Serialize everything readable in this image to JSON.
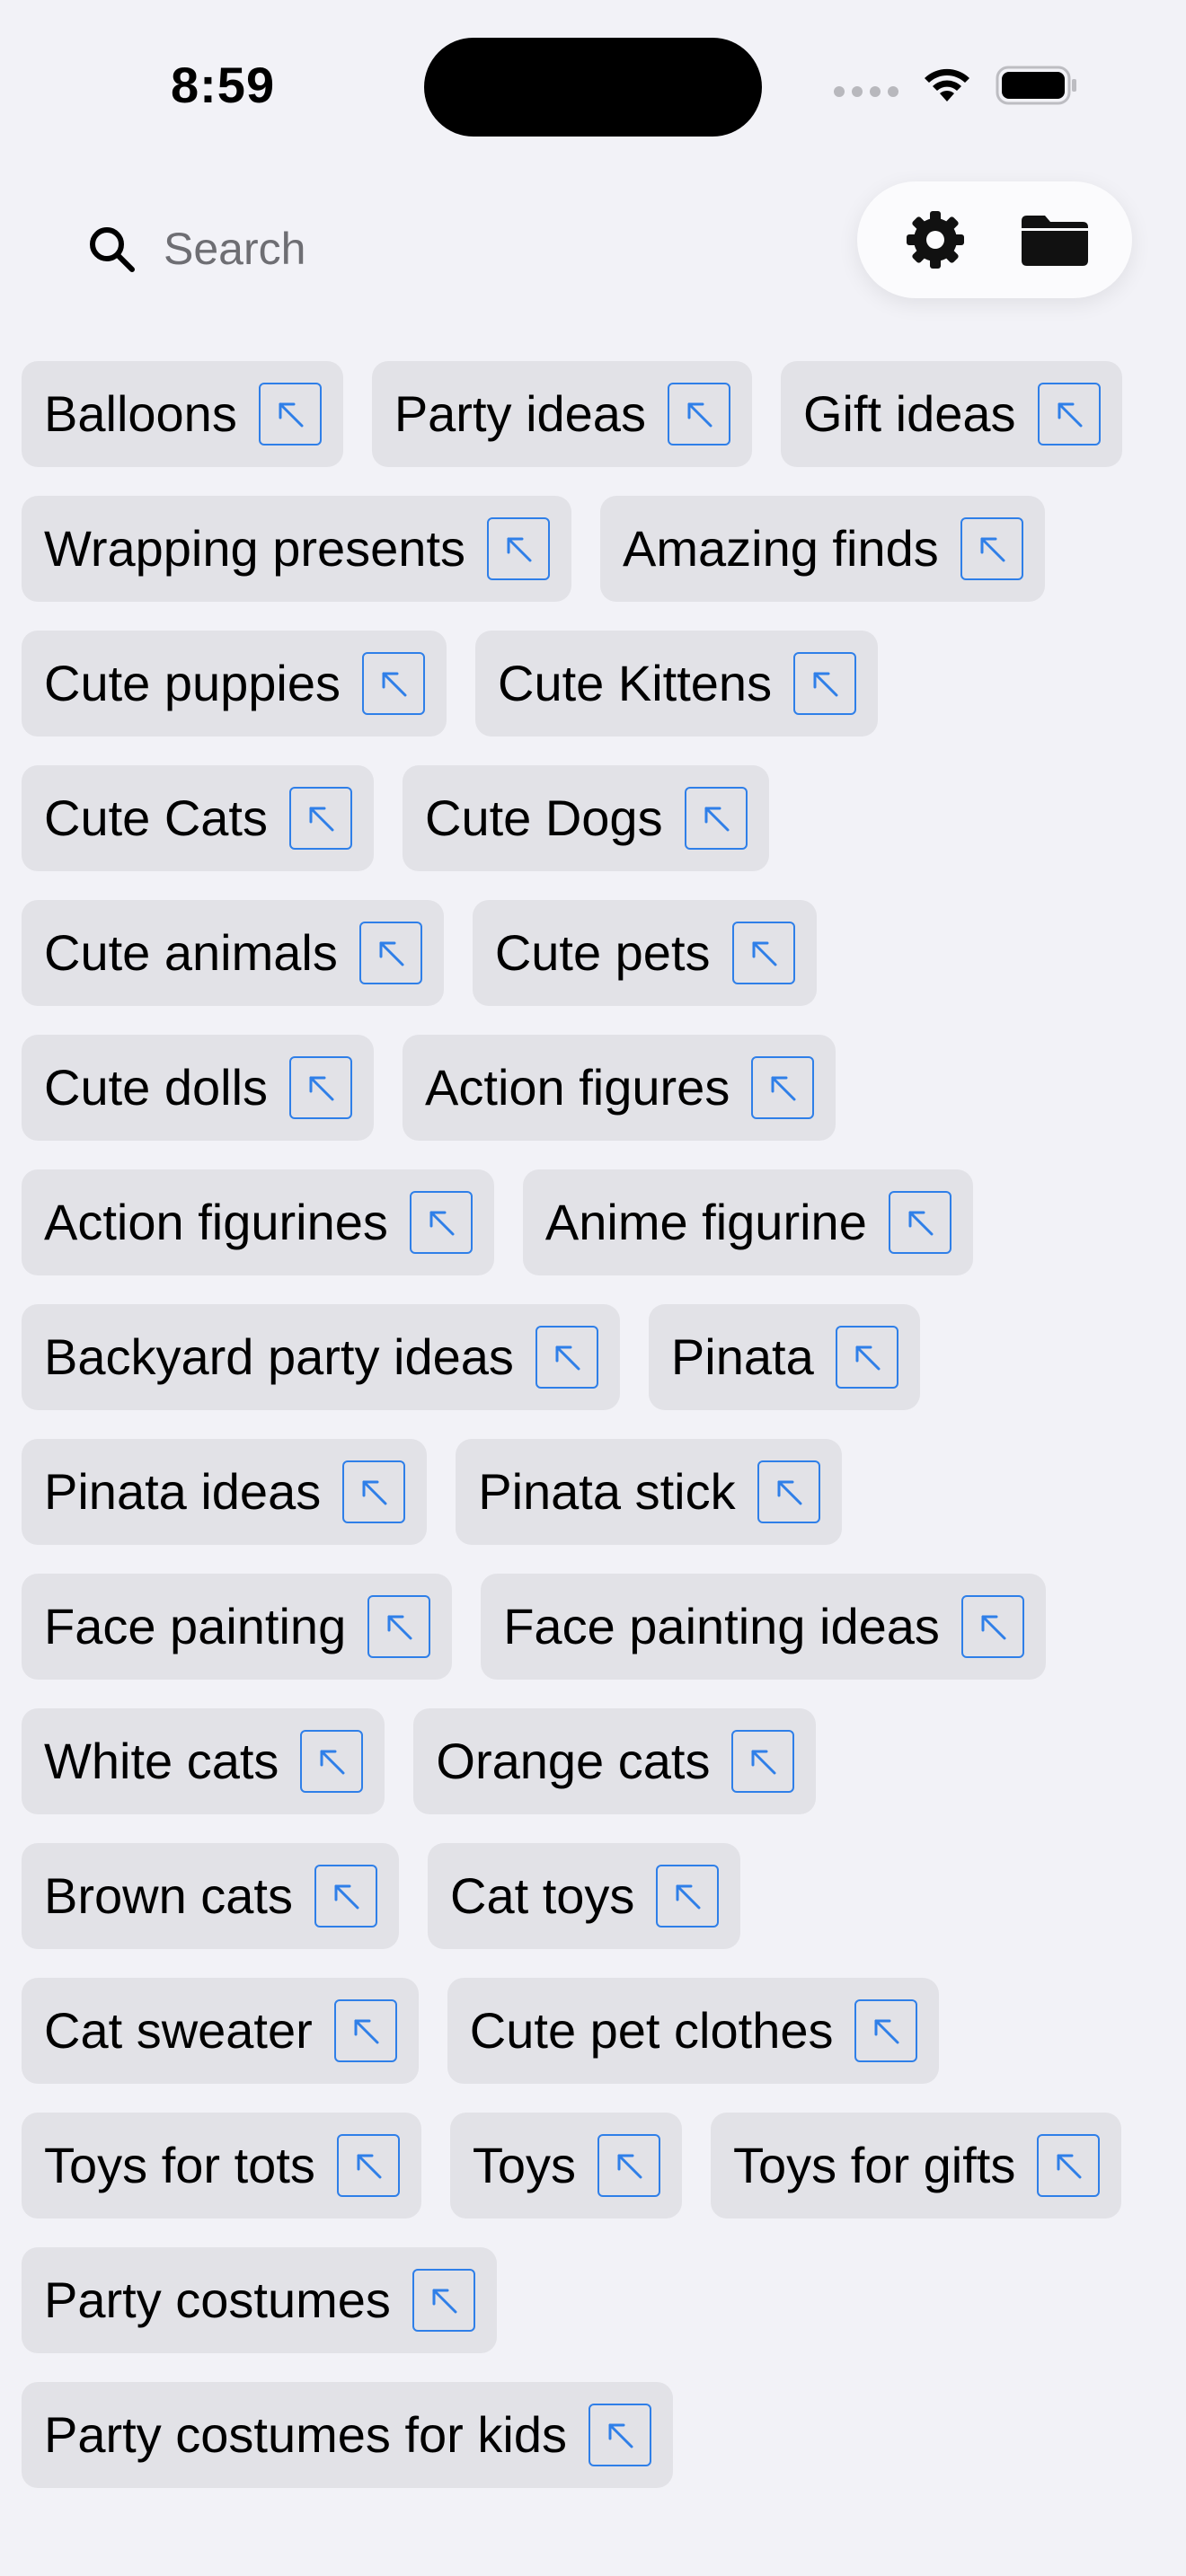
{
  "status_bar": {
    "time": "8:59"
  },
  "search": {
    "placeholder": "Search"
  },
  "icons": {
    "search": "search-icon",
    "settings": "gear-icon",
    "folder": "folder-icon",
    "chip_action": "arrow-up-left-icon"
  },
  "colors": {
    "background": "#f2f2f7",
    "chip_background": "#e2e2e7",
    "accent": "#2f7fe8"
  },
  "suggestions": [
    "Balloons",
    "Party ideas",
    "Gift ideas",
    "Wrapping presents",
    "Amazing finds",
    "Cute puppies",
    "Cute Kittens",
    "Cute Cats",
    "Cute Dogs",
    "Cute animals",
    "Cute pets",
    "Cute dolls",
    "Action figures",
    "Action figurines",
    "Anime figurine",
    "Backyard party ideas",
    "Pinata",
    "Pinata ideas",
    "Pinata stick",
    "Face painting",
    "Face painting ideas",
    "White cats",
    "Orange cats",
    "Brown cats",
    "Cat toys",
    "Cat sweater",
    "Cute pet clothes",
    "Toys for tots",
    "Toys",
    "Toys for gifts",
    "Party costumes",
    "Party costumes for kids"
  ]
}
